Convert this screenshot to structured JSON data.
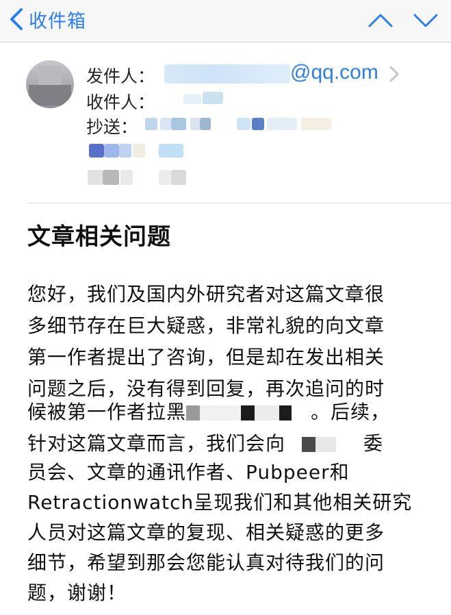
{
  "nav": {
    "back_label": "收件箱",
    "back_icon": "chevron-left-icon",
    "prev_icon": "chevron-up-icon",
    "next_icon": "chevron-down-icon",
    "accent_color": "#2a7df6"
  },
  "header": {
    "from_label": "发件人：",
    "from_email_visible": "@qq.com",
    "to_label": "收件人：",
    "cc_label": "抄送："
  },
  "subject": "文章相关问题",
  "body": {
    "lines": [
      "您好，我们及国内外研究者对这篇文章很",
      "多细节存在巨大疑惑，非常礼貌的向文章",
      "第一作者提出了咨询，但是却在发出相关",
      "问题之后，没有得到回复，再次追问的时"
    ],
    "line5_before": "候被第一作者拉黑",
    "line5_after": "。后续，",
    "line6_before": "针对这篇文章而言，我们会向",
    "line6_after": "委",
    "lines_rest": [
      "员会、文章的通讯作者、Pubpeer和",
      "Retractionwatch呈现我们和其他相关研究",
      "人员对这篇文章的复现、相关疑惑的更多",
      "细节，希望到那会您能认真对待我们的问",
      "题，谢谢！"
    ]
  }
}
